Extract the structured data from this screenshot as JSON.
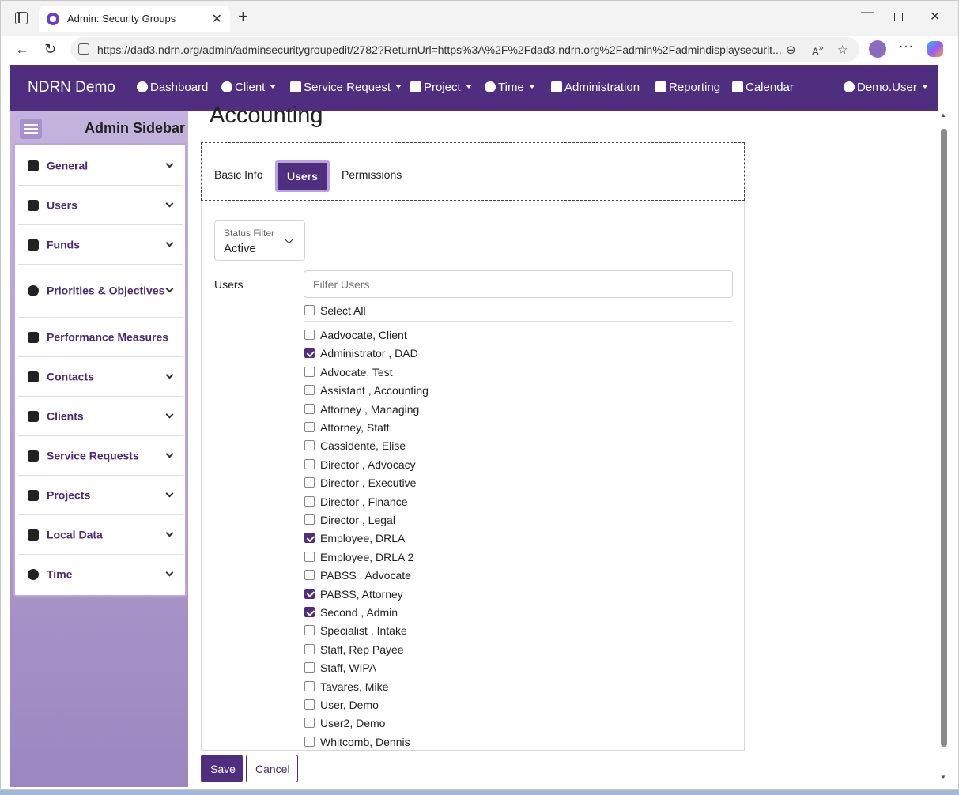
{
  "browser": {
    "tab_title": "Admin: Security Groups",
    "url": "https://dad3.ndrn.org/admin/adminsecuritygroupedit/2782?ReturnUrl=https%3A%2F%2Fdad3.ndrn.org%2Fadmin%2Fadmindisplaysecurit..."
  },
  "navbar": {
    "brand": "NDRN Demo",
    "items": [
      {
        "label": "Dashboard",
        "dropdown": false
      },
      {
        "label": "Client",
        "dropdown": true
      },
      {
        "label": "Service Request",
        "dropdown": true
      },
      {
        "label": "Project",
        "dropdown": true
      },
      {
        "label": "Time",
        "dropdown": true
      },
      {
        "label": "Administration",
        "dropdown": false
      },
      {
        "label": "Reporting",
        "dropdown": false
      },
      {
        "label": "Calendar",
        "dropdown": false
      }
    ],
    "user": "Demo.User"
  },
  "sidebar": {
    "title": "Admin Sidebar",
    "items": [
      {
        "label": "General",
        "icon": "tools-icon",
        "expandable": true
      },
      {
        "label": "Users",
        "icon": "users-icon",
        "expandable": true
      },
      {
        "label": "Funds",
        "icon": "money-bag-icon",
        "expandable": true
      },
      {
        "label": "Priorities & Objectives",
        "icon": "target-icon",
        "expandable": true
      },
      {
        "label": "Performance Measures",
        "icon": "scale-icon",
        "expandable": false
      },
      {
        "label": "Contacts",
        "icon": "contacts-icon",
        "expandable": true
      },
      {
        "label": "Clients",
        "icon": "person-icon",
        "expandable": true
      },
      {
        "label": "Service Requests",
        "icon": "briefcase-icon",
        "expandable": true
      },
      {
        "label": "Projects",
        "icon": "clipboard-icon",
        "expandable": true
      },
      {
        "label": "Local Data",
        "icon": "house-icon",
        "expandable": true
      },
      {
        "label": "Time",
        "icon": "clock-icon",
        "expandable": true
      }
    ]
  },
  "main": {
    "title": "Accounting",
    "tabs": [
      {
        "label": "Basic Info",
        "active": false
      },
      {
        "label": "Users",
        "active": true
      },
      {
        "label": "Permissions",
        "active": false
      }
    ],
    "status_filter": {
      "caption": "Status Filter",
      "value": "Active"
    },
    "users_label": "Users",
    "filter_placeholder": "Filter Users",
    "select_all": "Select All",
    "users": [
      {
        "name": "Aadvocate, Client",
        "checked": false
      },
      {
        "name": "Administrator , DAD",
        "checked": true
      },
      {
        "name": "Advocate, Test",
        "checked": false
      },
      {
        "name": "Assistant , Accounting",
        "checked": false
      },
      {
        "name": "Attorney , Managing",
        "checked": false
      },
      {
        "name": "Attorney, Staff",
        "checked": false
      },
      {
        "name": "Cassidente, Elise",
        "checked": false
      },
      {
        "name": "Director , Advocacy",
        "checked": false
      },
      {
        "name": "Director , Executive",
        "checked": false
      },
      {
        "name": "Director , Finance",
        "checked": false
      },
      {
        "name": "Director , Legal",
        "checked": false
      },
      {
        "name": "Employee, DRLA",
        "checked": true
      },
      {
        "name": "Employee, DRLA 2",
        "checked": false
      },
      {
        "name": "PABSS , Advocate",
        "checked": false
      },
      {
        "name": "PABSS, Attorney",
        "checked": true
      },
      {
        "name": "Second , Admin",
        "checked": true
      },
      {
        "name": "Specialist , Intake",
        "checked": false
      },
      {
        "name": "Staff, Rep Payee",
        "checked": false
      },
      {
        "name": "Staff, WIPA",
        "checked": false
      },
      {
        "name": "Tavares, Mike",
        "checked": false
      },
      {
        "name": "User, Demo",
        "checked": false
      },
      {
        "name": "User2, Demo",
        "checked": false
      },
      {
        "name": "Whitcomb, Dennis",
        "checked": false
      }
    ],
    "save_label": "Save",
    "cancel_label": "Cancel"
  },
  "colors": {
    "brand": "#4f2d7f",
    "sidebar": "#9c86c0"
  }
}
